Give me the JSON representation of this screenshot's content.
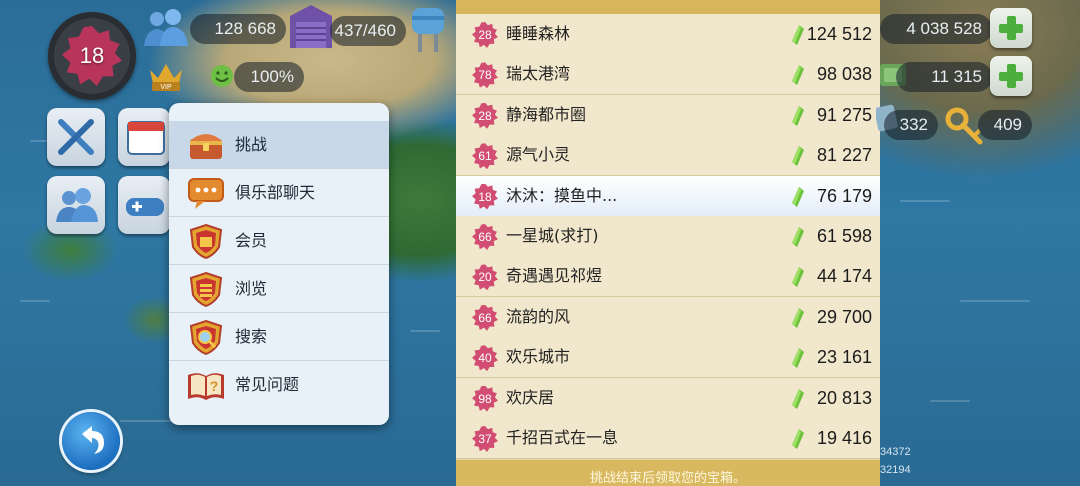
{
  "hud": {
    "player_level": "18",
    "population": "128 668",
    "storage": "437/460",
    "happiness": "100%",
    "simoleons": "4 038 528",
    "simcash": "11 315",
    "golden_keys": "332",
    "platinum_keys": "409",
    "coord_1": "34372",
    "coord_2": "32194"
  },
  "menu": {
    "items": [
      {
        "label": "挑战",
        "icon": "treasure-chest-icon"
      },
      {
        "label": "俱乐部聊天",
        "icon": "chat-bubble-icon"
      },
      {
        "label": "会员",
        "icon": "members-shield-icon"
      },
      {
        "label": "浏览",
        "icon": "browse-shield-icon"
      },
      {
        "label": "搜索",
        "icon": "search-shield-icon"
      },
      {
        "label": "常见问题",
        "icon": "faq-book-icon"
      }
    ]
  },
  "leaderboard": {
    "rows": [
      {
        "level": "28",
        "name": "睡睡森林",
        "score": "124 512"
      },
      {
        "level": "78",
        "name": "瑞太港湾",
        "score": "98 038"
      },
      {
        "level": "28",
        "name": "静海都市圈",
        "score": "91 275"
      },
      {
        "level": "61",
        "name": "源气小灵",
        "score": "81 227"
      },
      {
        "level": "18",
        "name": "沐沐：摸鱼中...",
        "score": "76 179"
      },
      {
        "level": "66",
        "name": "一星城(求打)",
        "score": "61 598"
      },
      {
        "level": "20",
        "name": "奇遇遇见祁煜",
        "score": "44 174"
      },
      {
        "level": "66",
        "name": "流韵的风",
        "score": "29 700"
      },
      {
        "level": "40",
        "name": "欢乐城市",
        "score": "23 161"
      },
      {
        "level": "98",
        "name": "欢庆居",
        "score": "20 813"
      },
      {
        "level": "37",
        "name": "千招百式在一息",
        "score": "19 416"
      }
    ],
    "footer": "挑战结束后领取您的宝箱。"
  },
  "colors": {
    "badge": "#d24d72",
    "gem": "#6cc23a",
    "board_bg": "#f1e7cc",
    "highlight_row": "#e2edf8"
  }
}
